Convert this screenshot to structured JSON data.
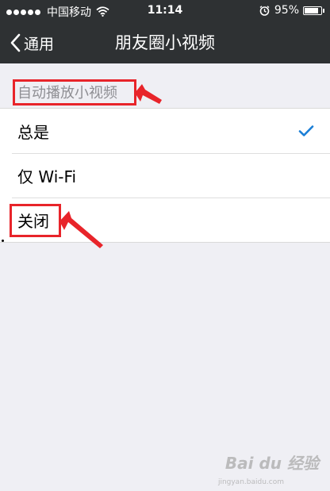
{
  "status_bar": {
    "carrier": "中国移动",
    "time": "11:14",
    "battery_percent": "95%",
    "battery_level": 0.95,
    "icons": [
      "signal-icon",
      "wifi-icon",
      "alarm-icon",
      "battery-icon"
    ]
  },
  "nav": {
    "back_label": "通用",
    "title": "朋友圈小视频"
  },
  "section": {
    "header": "自动播放小视频"
  },
  "options": [
    {
      "label": "总是",
      "selected": true
    },
    {
      "label": "仅 Wi-Fi",
      "selected": false
    },
    {
      "label": "关闭",
      "selected": false
    }
  ],
  "colors": {
    "nav_background": "#2e3133",
    "page_background": "#efeff4",
    "checkmark": "#1a7ed6",
    "annotation": "#e8242a"
  },
  "watermark": {
    "text": "Bai du 经验",
    "sub": "jingyan.baidu.com"
  }
}
